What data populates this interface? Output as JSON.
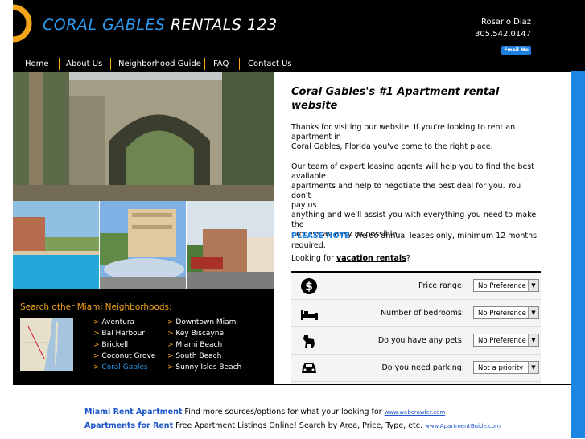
{
  "header": {
    "title_part1": "CORAL GABLES",
    "title_part2": "RENTALS 123",
    "contact_name": "Rosario Diaz",
    "contact_phone": "305.542.0147",
    "email_button": "Email Me"
  },
  "nav": {
    "items": [
      "Home",
      "About Us",
      "Neighborhood Guide",
      "FAQ",
      "Contact Us"
    ]
  },
  "main": {
    "heading": "Coral Gables's #1 Apartment rental website",
    "para1_line1": "Thanks for visiting our website. If you're looking to rent an",
    "para1_line2": "apartment in",
    "para1_line3": "Coral Gables, Florida you've come to the right place.",
    "para2_line1": "Our team of expert leasing agents will help you to find the best",
    "para2_line2": "available",
    "para2_line3": "apartments and help to negotiate the best deal for you. You don't",
    "para2_line4": "pay us",
    "para2_line5": "anything and we'll assist you with everything you need to make the",
    "para2_line6": "process as easy as possible.",
    "note_label": "PLEASE NOTE",
    "note_text": "- We do annual leases only, minimum 12 months",
    "note_text2": "required.",
    "vacation_prefix": "Looking for ",
    "vacation_link": "vacation rentals",
    "vacation_suffix": "?"
  },
  "form": {
    "rows": [
      {
        "icon": "dollar-icon",
        "label": "Price range:",
        "value": "No Preference"
      },
      {
        "icon": "bed-icon",
        "label": "Number of bedrooms:",
        "value": "No Preference"
      },
      {
        "icon": "dog-icon",
        "label": "Do you have any pets:",
        "value": "No Preference"
      },
      {
        "icon": "car-icon",
        "label": "Do you need parking:",
        "value": "Not a priority"
      }
    ],
    "dropdown_glyph": "▼"
  },
  "search": {
    "title": "Search other Miami Neighborhoods:",
    "col1": [
      "Aventura",
      "Bal Harbour",
      "Brickell",
      "Coconut Grove",
      "Coral Gables"
    ],
    "col2": [
      "Downtown Miami",
      "Key Biscayne",
      "Miami Beach",
      "South Beach",
      "Sunny Isles Beach"
    ],
    "arrow": ">"
  },
  "footer": {
    "lines": [
      {
        "link": "Miami Rent Apartment",
        "text": " Find more sources/options for what your looking for ",
        "url": "www.webcrawler.com"
      },
      {
        "link": "Apartments for Rent",
        "text": " Free Apartment Listings Online! Search by Area, Price, Type, etc. ",
        "url": "www.ApartmentGuide.com"
      }
    ]
  },
  "colors": {
    "accent_orange": "#f5a418",
    "accent_blue": "#1c86e4",
    "header_bg": "#000000"
  }
}
